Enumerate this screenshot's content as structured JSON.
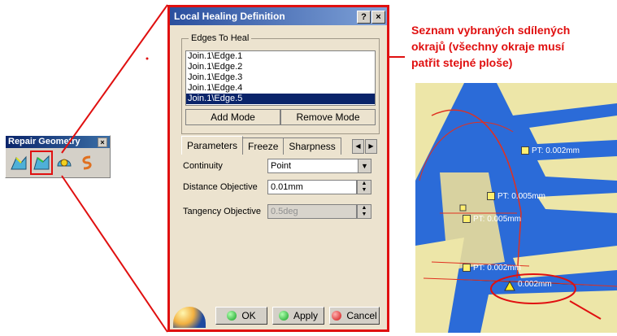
{
  "toolbar": {
    "title": "Repair Geometry",
    "close_symbol": "×",
    "icons": [
      "join-surfaces-icon",
      "local-healing-icon",
      "untrim-icon",
      "disassemble-icon"
    ]
  },
  "dialog": {
    "title": "Local Healing Definition",
    "help_symbol": "?",
    "close_symbol": "×",
    "group_label": "Edges To Heal",
    "edges": [
      "Join.1\\Edge.1",
      "Join.1\\Edge.2",
      "Join.1\\Edge.3",
      "Join.1\\Edge.4",
      "Join.1\\Edge.5"
    ],
    "selected_edge_index": 4,
    "add_mode": "Add Mode",
    "remove_mode": "Remove Mode",
    "tabs": [
      "Parameters",
      "Freeze",
      "Sharpness"
    ],
    "active_tab": "Parameters",
    "continuity_label": "Continuity",
    "continuity_value": "Point",
    "distance_label": "Distance Objective",
    "distance_value": "0.01mm",
    "tangency_label": "Tangency Objective",
    "tangency_value": "0.5deg",
    "ok": "OK",
    "apply": "Apply",
    "cancel": "Cancel"
  },
  "annotation": {
    "lines": [
      "Seznam vybraných sdílených",
      "okrajů (všechny okraje musí",
      "patřit stejné ploše)"
    ],
    "color": "#e01010"
  },
  "view": {
    "labels": [
      "PT: 0.002mm",
      "PT: 0.005mm",
      "PT: 0.005mm",
      "PT: 0.002mm",
      "0.002mm"
    ],
    "surface_color": "#2b6bd8",
    "highlight_color": "#f0ecb8"
  }
}
